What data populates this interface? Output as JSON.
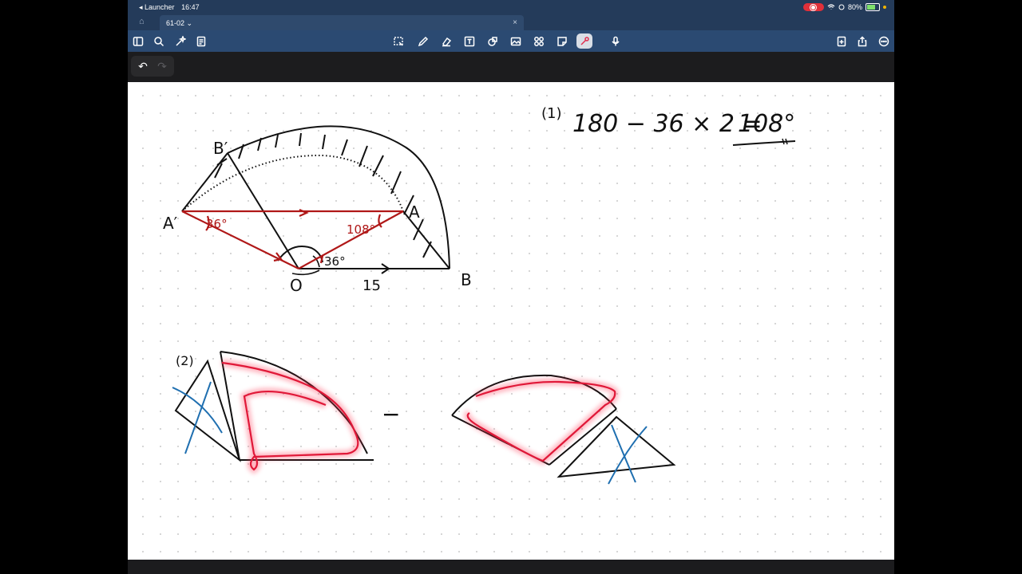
{
  "status": {
    "back_app": "◂ Launcher",
    "time": "16:47",
    "battery": "80%"
  },
  "tab": {
    "title": "61-02",
    "chevron": "⌄",
    "close": "×"
  },
  "toolbar": {
    "left": [
      "sidebar-icon",
      "search-icon",
      "magic-icon",
      "document-icon"
    ],
    "center": [
      "lasso-icon",
      "pen-icon",
      "eraser-icon",
      "text-icon",
      "shapes-icon",
      "image-icon",
      "elements-icon",
      "sticky-note-icon",
      "laser-pointer-icon",
      "microphone-icon"
    ],
    "right": [
      "add-page-icon",
      "share-icon",
      "more-icon"
    ]
  },
  "undo": {
    "undo": "↶",
    "redo": "↷"
  },
  "notes": {
    "part1_label": "(1)",
    "equation_lhs": "180 − 36 × 2 =",
    "equation_rhs": "108°",
    "point_b_prime": "B′",
    "point_a_prime": "A′",
    "point_a": "A",
    "point_b": "B",
    "point_o": "O",
    "length_ob": "15",
    "angle_left": "36°",
    "angle_right": "108°",
    "angle_at_o": "36°",
    "part2_label": "(2)",
    "minus_sign": "−"
  },
  "colors": {
    "status_bg": "#243b5a",
    "toolbar_bg": "#2b4a72",
    "ink": "#111111",
    "red_ink": "#b01818",
    "highlight": "#ff3050",
    "blue_ink": "#1f6fb0"
  }
}
